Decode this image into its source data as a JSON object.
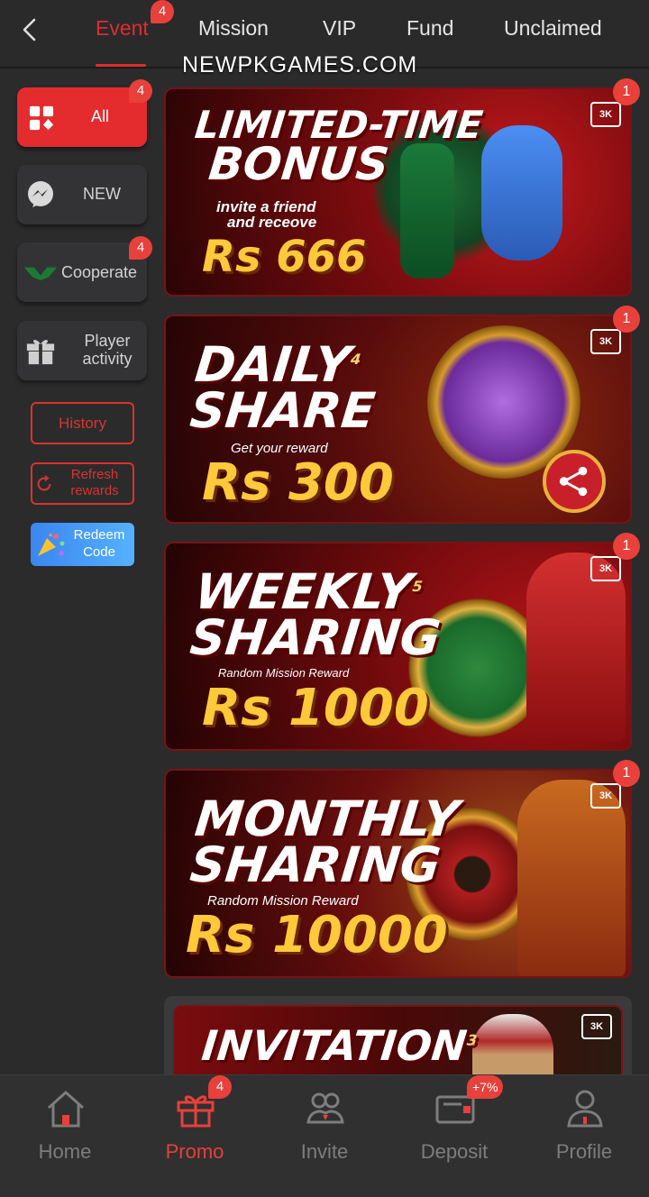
{
  "tabs": [
    {
      "label": "Event",
      "badge": "4",
      "active": true
    },
    {
      "label": "Mission"
    },
    {
      "label": "VIP"
    },
    {
      "label": "Fund"
    },
    {
      "label": "Unclaimed"
    }
  ],
  "watermark": "NEWPKGAMES.COM",
  "sidebar": {
    "all": {
      "label": "All",
      "badge": "4"
    },
    "new": {
      "label": "NEW"
    },
    "cooperate": {
      "label": "Cooperate",
      "badge": "4"
    },
    "player_activity": {
      "label": "Player activity"
    },
    "history": "History",
    "refresh": "Refresh rewards",
    "redeem": "Redeem Code"
  },
  "banners": [
    {
      "title_line1": "LIMITED-TIME",
      "title_line2": "BONUS",
      "sub_line1": "invite a friend",
      "sub_line2": "and receove",
      "amount": "Rs 666",
      "badge": "1"
    },
    {
      "title_line1": "DAILY",
      "title_line2": "SHARE",
      "superscript": "4",
      "sub": "Get your reward",
      "amount": "Rs 300",
      "badge": "1"
    },
    {
      "title_line1": "WEEKLY",
      "title_line2": "SHARING",
      "superscript": "5",
      "sub": "Random Mission Reward",
      "amount": "Rs 1000",
      "badge": "1"
    },
    {
      "title_line1": "MONTHLY",
      "title_line2": "SHARING",
      "sub": "Random Mission Reward",
      "amount": "Rs 10000",
      "badge": "1"
    },
    {
      "title_line1": "INVITATION",
      "superscript": "3"
    }
  ],
  "bottom_nav": [
    {
      "label": "Home"
    },
    {
      "label": "Promo",
      "badge": "4",
      "active": true
    },
    {
      "label": "Invite"
    },
    {
      "label": "Deposit",
      "badge": "+7%"
    },
    {
      "label": "Profile"
    }
  ],
  "colors": {
    "accent": "#e02c2c",
    "background": "#2b2b2c",
    "gold": "#ffc93a"
  }
}
